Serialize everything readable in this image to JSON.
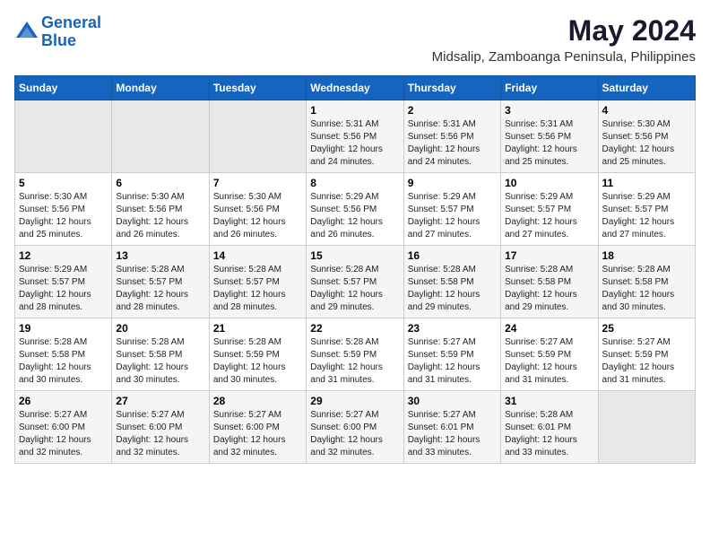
{
  "header": {
    "logo_line1": "General",
    "logo_line2": "Blue",
    "main_title": "May 2024",
    "subtitle": "Midsalip, Zamboanga Peninsula, Philippines"
  },
  "weekdays": [
    "Sunday",
    "Monday",
    "Tuesday",
    "Wednesday",
    "Thursday",
    "Friday",
    "Saturday"
  ],
  "weeks": [
    [
      {
        "day": "",
        "info": ""
      },
      {
        "day": "",
        "info": ""
      },
      {
        "day": "",
        "info": ""
      },
      {
        "day": "1",
        "info": "Sunrise: 5:31 AM\nSunset: 5:56 PM\nDaylight: 12 hours\nand 24 minutes."
      },
      {
        "day": "2",
        "info": "Sunrise: 5:31 AM\nSunset: 5:56 PM\nDaylight: 12 hours\nand 24 minutes."
      },
      {
        "day": "3",
        "info": "Sunrise: 5:31 AM\nSunset: 5:56 PM\nDaylight: 12 hours\nand 25 minutes."
      },
      {
        "day": "4",
        "info": "Sunrise: 5:30 AM\nSunset: 5:56 PM\nDaylight: 12 hours\nand 25 minutes."
      }
    ],
    [
      {
        "day": "5",
        "info": "Sunrise: 5:30 AM\nSunset: 5:56 PM\nDaylight: 12 hours\nand 25 minutes."
      },
      {
        "day": "6",
        "info": "Sunrise: 5:30 AM\nSunset: 5:56 PM\nDaylight: 12 hours\nand 26 minutes."
      },
      {
        "day": "7",
        "info": "Sunrise: 5:30 AM\nSunset: 5:56 PM\nDaylight: 12 hours\nand 26 minutes."
      },
      {
        "day": "8",
        "info": "Sunrise: 5:29 AM\nSunset: 5:56 PM\nDaylight: 12 hours\nand 26 minutes."
      },
      {
        "day": "9",
        "info": "Sunrise: 5:29 AM\nSunset: 5:57 PM\nDaylight: 12 hours\nand 27 minutes."
      },
      {
        "day": "10",
        "info": "Sunrise: 5:29 AM\nSunset: 5:57 PM\nDaylight: 12 hours\nand 27 minutes."
      },
      {
        "day": "11",
        "info": "Sunrise: 5:29 AM\nSunset: 5:57 PM\nDaylight: 12 hours\nand 27 minutes."
      }
    ],
    [
      {
        "day": "12",
        "info": "Sunrise: 5:29 AM\nSunset: 5:57 PM\nDaylight: 12 hours\nand 28 minutes."
      },
      {
        "day": "13",
        "info": "Sunrise: 5:28 AM\nSunset: 5:57 PM\nDaylight: 12 hours\nand 28 minutes."
      },
      {
        "day": "14",
        "info": "Sunrise: 5:28 AM\nSunset: 5:57 PM\nDaylight: 12 hours\nand 28 minutes."
      },
      {
        "day": "15",
        "info": "Sunrise: 5:28 AM\nSunset: 5:57 PM\nDaylight: 12 hours\nand 29 minutes."
      },
      {
        "day": "16",
        "info": "Sunrise: 5:28 AM\nSunset: 5:58 PM\nDaylight: 12 hours\nand 29 minutes."
      },
      {
        "day": "17",
        "info": "Sunrise: 5:28 AM\nSunset: 5:58 PM\nDaylight: 12 hours\nand 29 minutes."
      },
      {
        "day": "18",
        "info": "Sunrise: 5:28 AM\nSunset: 5:58 PM\nDaylight: 12 hours\nand 30 minutes."
      }
    ],
    [
      {
        "day": "19",
        "info": "Sunrise: 5:28 AM\nSunset: 5:58 PM\nDaylight: 12 hours\nand 30 minutes."
      },
      {
        "day": "20",
        "info": "Sunrise: 5:28 AM\nSunset: 5:58 PM\nDaylight: 12 hours\nand 30 minutes."
      },
      {
        "day": "21",
        "info": "Sunrise: 5:28 AM\nSunset: 5:59 PM\nDaylight: 12 hours\nand 30 minutes."
      },
      {
        "day": "22",
        "info": "Sunrise: 5:28 AM\nSunset: 5:59 PM\nDaylight: 12 hours\nand 31 minutes."
      },
      {
        "day": "23",
        "info": "Sunrise: 5:27 AM\nSunset: 5:59 PM\nDaylight: 12 hours\nand 31 minutes."
      },
      {
        "day": "24",
        "info": "Sunrise: 5:27 AM\nSunset: 5:59 PM\nDaylight: 12 hours\nand 31 minutes."
      },
      {
        "day": "25",
        "info": "Sunrise: 5:27 AM\nSunset: 5:59 PM\nDaylight: 12 hours\nand 31 minutes."
      }
    ],
    [
      {
        "day": "26",
        "info": "Sunrise: 5:27 AM\nSunset: 6:00 PM\nDaylight: 12 hours\nand 32 minutes."
      },
      {
        "day": "27",
        "info": "Sunrise: 5:27 AM\nSunset: 6:00 PM\nDaylight: 12 hours\nand 32 minutes."
      },
      {
        "day": "28",
        "info": "Sunrise: 5:27 AM\nSunset: 6:00 PM\nDaylight: 12 hours\nand 32 minutes."
      },
      {
        "day": "29",
        "info": "Sunrise: 5:27 AM\nSunset: 6:00 PM\nDaylight: 12 hours\nand 32 minutes."
      },
      {
        "day": "30",
        "info": "Sunrise: 5:27 AM\nSunset: 6:01 PM\nDaylight: 12 hours\nand 33 minutes."
      },
      {
        "day": "31",
        "info": "Sunrise: 5:28 AM\nSunset: 6:01 PM\nDaylight: 12 hours\nand 33 minutes."
      },
      {
        "day": "",
        "info": ""
      }
    ]
  ]
}
